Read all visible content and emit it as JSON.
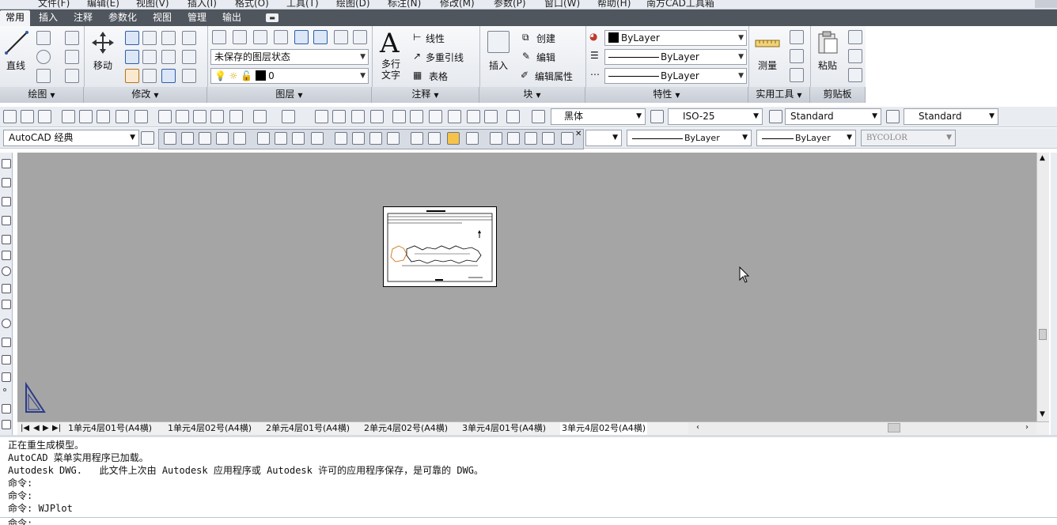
{
  "menubar": [
    "文件(F)",
    "编辑(E)",
    "视图(V)",
    "插入(I)",
    "格式(O)",
    "工具(T)",
    "绘图(D)",
    "标注(N)",
    "修改(M)",
    "参数(P)",
    "窗口(W)",
    "帮助(H)",
    "南方CAD工具箱"
  ],
  "ribbon_tabs": [
    {
      "label": "常用",
      "active": true
    },
    {
      "label": "插入"
    },
    {
      "label": "注释"
    },
    {
      "label": "参数化"
    },
    {
      "label": "视图"
    },
    {
      "label": "管理"
    },
    {
      "label": "输出"
    }
  ],
  "ribbon": {
    "draw": {
      "line_label": "直线",
      "panel": "绘图"
    },
    "modify": {
      "move_label": "移动",
      "panel": "修改"
    },
    "layers": {
      "state": "未保存的图层状态",
      "layer_value": "0",
      "panel": "图层"
    },
    "annotation": {
      "text_label": "多行文字",
      "linear": "线性",
      "mleader": "多重引线",
      "table": "表格",
      "panel": "注释"
    },
    "block": {
      "insert": "插入",
      "create": "创建",
      "edit": "编辑",
      "edit_attr": "编辑属性",
      "panel": "块"
    },
    "properties": {
      "color": "ByLayer",
      "linetype": "ByLayer",
      "lineweight": "ByLayer",
      "panel": "特性"
    },
    "utilities": {
      "measure": "测量",
      "panel": "实用工具"
    },
    "clipboard": {
      "paste": "粘贴",
      "panel": "剪贴板"
    }
  },
  "toolbar1": {
    "text_style": "黑体",
    "dim_style": "ISO-25",
    "table_style": "Standard",
    "mleader_style": "Standard"
  },
  "toolbar2": {
    "workspace": "AutoCAD 经典",
    "linetype": "ByLayer",
    "lineweight": "ByLayer",
    "plotstyle": "BYCOLOR"
  },
  "layout_tabs": [
    {
      "label": "1单元4层01号(A4横)"
    },
    {
      "label": "1单元4层02号(A4横)"
    },
    {
      "label": "2单元4层01号(A4横)"
    },
    {
      "label": "2单元4层02号(A4横)"
    },
    {
      "label": "3单元4层01号(A4横)"
    },
    {
      "label": "3单元4层02号(A4横)",
      "active": true
    }
  ],
  "command_history": [
    "正在重生成模型。",
    "AutoCAD 菜单实用程序已加载。",
    "Autodesk DWG.   此文件上次由 Autodesk 应用程序或 Autodesk 许可的应用程序保存，是可靠的 DWG。",
    "命令:",
    "命令:",
    "命令: WJPlot"
  ],
  "command_prompt": "命令:",
  "colors": {
    "ribbon_tabbar": "#50565e",
    "canvas": "#a5a5a5",
    "accent": "#2f5da8"
  }
}
